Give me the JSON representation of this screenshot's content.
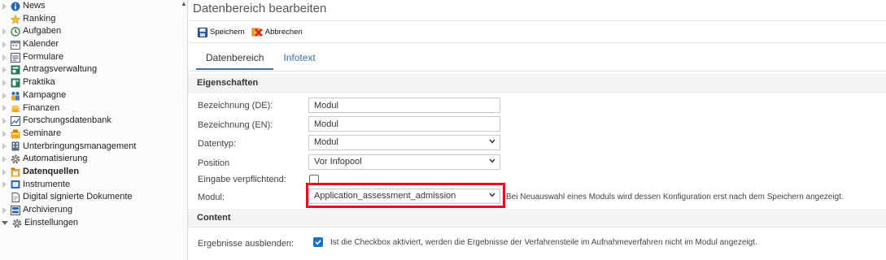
{
  "sidebar": {
    "items": [
      {
        "label": "News",
        "icon": "info-icon",
        "expand": "closed"
      },
      {
        "label": "Ranking",
        "icon": "ranking-icon",
        "expand": "none"
      },
      {
        "label": "Aufgaben",
        "icon": "tasks-icon",
        "expand": "closed"
      },
      {
        "label": "Kalender",
        "icon": "calendar-icon",
        "expand": "closed"
      },
      {
        "label": "Formulare",
        "icon": "forms-icon",
        "expand": "closed"
      },
      {
        "label": "Antragsverwaltung",
        "icon": "applications-icon",
        "expand": "closed"
      },
      {
        "label": "Praktika",
        "icon": "internship-icon",
        "expand": "closed"
      },
      {
        "label": "Kampagne",
        "icon": "campaign-icon",
        "expand": "closed"
      },
      {
        "label": "Finanzen",
        "icon": "finance-icon",
        "expand": "closed"
      },
      {
        "label": "Forschungsdatenbank",
        "icon": "research-icon",
        "expand": "closed"
      },
      {
        "label": "Seminare",
        "icon": "seminar-icon",
        "expand": "closed"
      },
      {
        "label": "Unterbringungsmanagement",
        "icon": "building-icon",
        "expand": "closed"
      },
      {
        "label": "Automatisierung",
        "icon": "gear-icon",
        "expand": "closed"
      },
      {
        "label": "Datenquellen",
        "icon": "datasource-icon",
        "expand": "closed",
        "bold": true
      },
      {
        "label": "Instrumente",
        "icon": "instruments-icon",
        "expand": "closed"
      },
      {
        "label": "Digital signierte Dokumente",
        "icon": "document-icon",
        "expand": "none"
      },
      {
        "label": "Archivierung",
        "icon": "archive-icon",
        "expand": "closed"
      },
      {
        "label": "Einstellungen",
        "icon": "gear-icon",
        "expand": "open"
      }
    ]
  },
  "page": {
    "title": "Datenbereich bearbeiten"
  },
  "toolbar": {
    "save_label": "Speichern",
    "cancel_label": "Abbrechen"
  },
  "tabs": [
    {
      "label": "Datenbereich",
      "active": true
    },
    {
      "label": "Infotext",
      "active": false
    }
  ],
  "sections": {
    "properties": "Eigenschaften",
    "content": "Content"
  },
  "form": {
    "name_de": {
      "label": "Bezeichnung (DE):",
      "value": "Modul"
    },
    "name_en": {
      "label": "Bezeichnung (EN):",
      "value": "Modul"
    },
    "datatype": {
      "label": "Datentyp:",
      "value": "Modul"
    },
    "position": {
      "label": "Position",
      "value": "Vor Infopool"
    },
    "required": {
      "label": "Eingabe verpflichtend:",
      "checked": false
    },
    "module": {
      "label": "Modul:",
      "value": "Application_assessment_admission",
      "hint": "Bei Neuauswahl eines Moduls wird dessen Konfiguration erst nach dem Speichern angezeigt."
    },
    "hide_results": {
      "label": "Ergebnisse ausblenden:",
      "checked": true,
      "hint": "Ist die Checkbox aktiviert, werden die Ergebnisse der Verfahrensteile im Aufnahmeverfahren nicht im Modul angezeigt."
    }
  },
  "colors": {
    "accent": "#3b6fa8",
    "highlight": "#e1141c",
    "checkbox": "#1a73c8"
  }
}
